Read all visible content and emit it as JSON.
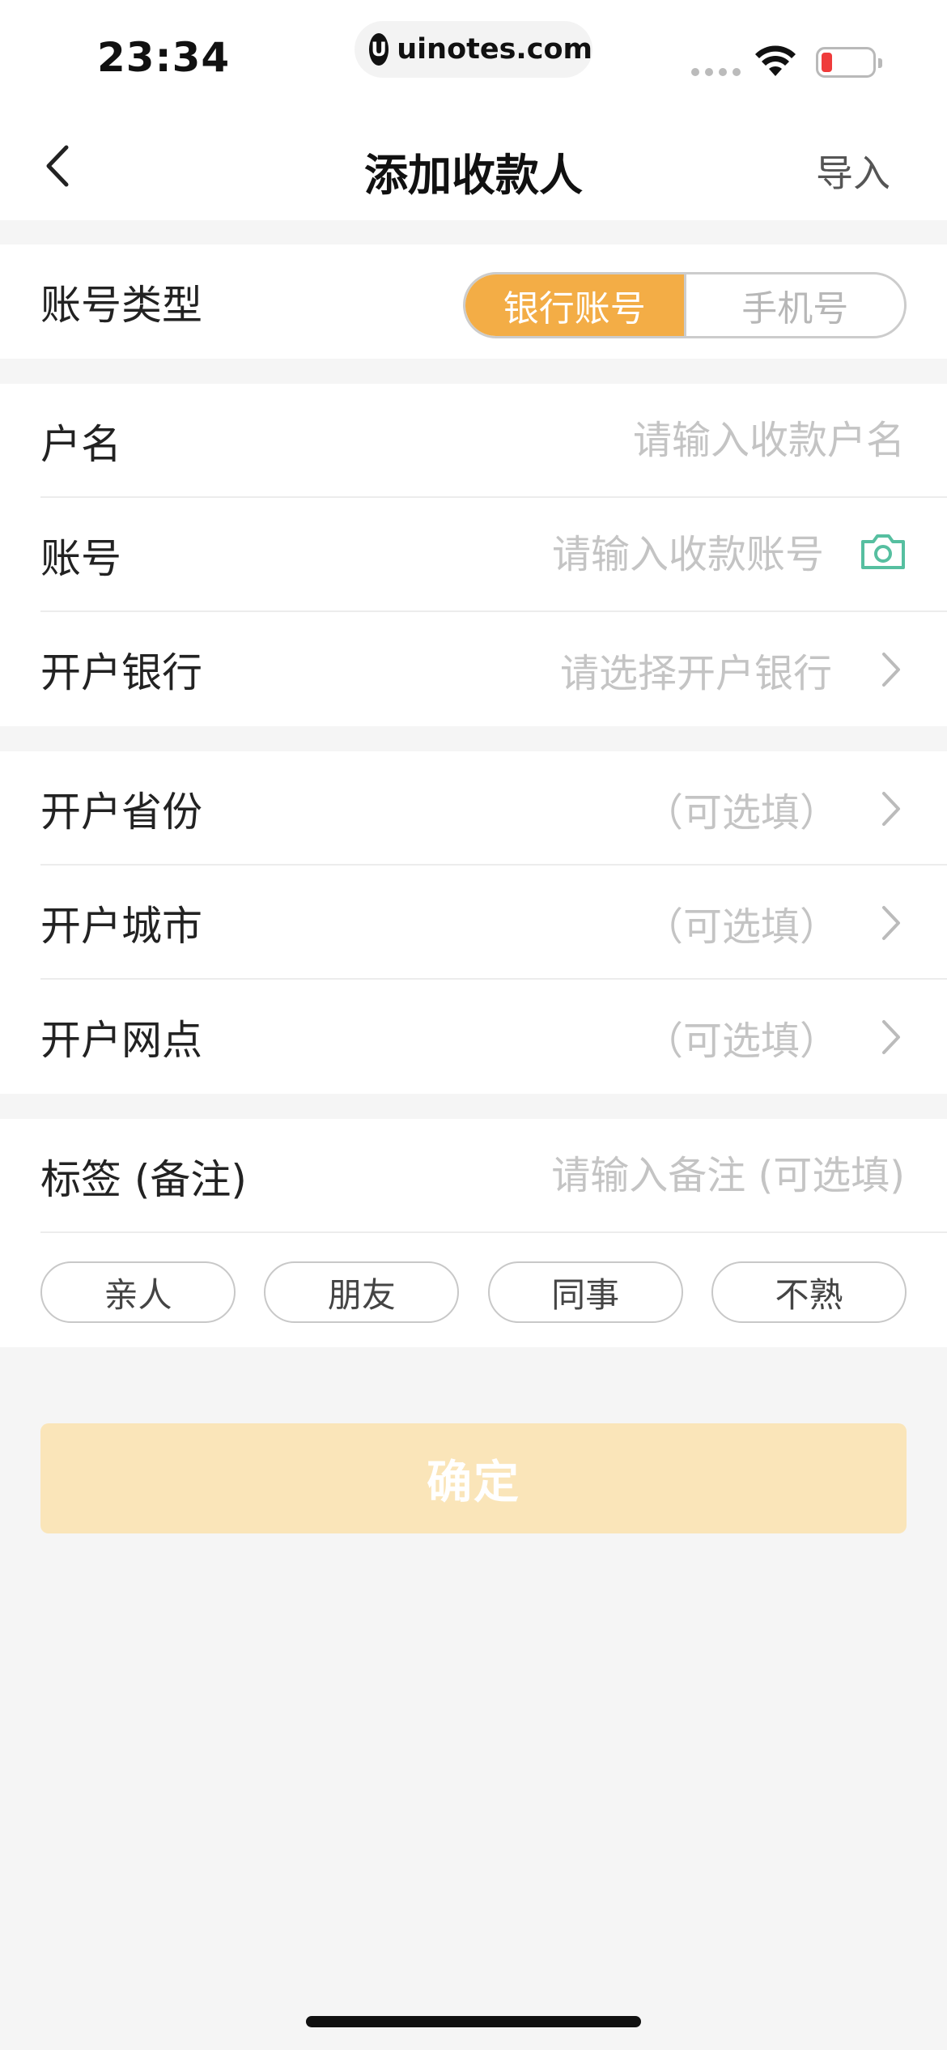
{
  "status_bar": {
    "time": "23:34",
    "url": "uinotes.com",
    "logo_glyph": "U"
  },
  "nav": {
    "title": "添加收款人",
    "import_label": "导入"
  },
  "account_type": {
    "label": "账号类型",
    "options": [
      "银行账号",
      "手机号"
    ],
    "selected": "银行账号"
  },
  "fields": {
    "name": {
      "label": "户名",
      "placeholder": "请输入收款户名"
    },
    "account": {
      "label": "账号",
      "placeholder": "请输入收款账号"
    },
    "bank": {
      "label": "开户银行",
      "placeholder": "请选择开户银行"
    },
    "province": {
      "label": "开户省份",
      "placeholder": "（可选填）"
    },
    "city": {
      "label": "开户城市",
      "placeholder": "（可选填）"
    },
    "branch": {
      "label": "开户网点",
      "placeholder": "（可选填）"
    },
    "tag": {
      "label": "标签 (备注)",
      "placeholder": "请输入备注 (可选填)"
    }
  },
  "tags": [
    "亲人",
    "朋友",
    "同事",
    "不熟"
  ],
  "confirm_label": "确定",
  "colors": {
    "accent": "#f3ad46",
    "confirm_disabled": "#fae5b9",
    "camera_icon": "#56bfa0"
  },
  "icons": [
    "back-chevron-icon",
    "camera-icon",
    "chevron-right-icon",
    "wifi-icon",
    "battery-icon"
  ]
}
